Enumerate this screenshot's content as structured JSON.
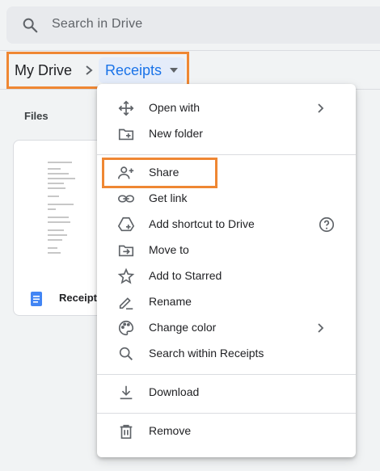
{
  "search": {
    "placeholder": "Search in Drive",
    "icon": "search-icon"
  },
  "breadcrumb": {
    "root": "My Drive",
    "current": "Receipts"
  },
  "files": {
    "section_label": "Files",
    "items": [
      {
        "name": "Receipt",
        "icon": "doc-icon"
      }
    ]
  },
  "context_menu": {
    "items": [
      {
        "label": "Open with",
        "icon": "open-with-icon",
        "has_submenu": true
      },
      {
        "label": "New folder",
        "icon": "new-folder-icon"
      },
      {
        "label": "Share",
        "icon": "share-icon",
        "highlighted": true
      },
      {
        "label": "Get link",
        "icon": "link-icon"
      },
      {
        "label": "Add shortcut to Drive",
        "icon": "add-shortcut-icon",
        "has_help": true
      },
      {
        "label": "Move to",
        "icon": "move-to-icon"
      },
      {
        "label": "Add to Starred",
        "icon": "star-icon"
      },
      {
        "label": "Rename",
        "icon": "rename-icon"
      },
      {
        "label": "Change color",
        "icon": "palette-icon",
        "has_submenu": true
      },
      {
        "label": "Search within Receipts",
        "icon": "search-icon"
      },
      {
        "label": "Download",
        "icon": "download-icon"
      },
      {
        "label": "Remove",
        "icon": "trash-icon"
      }
    ]
  },
  "colors": {
    "highlight": "#ef8733",
    "accent": "#1a73e8",
    "chip": "#e4ecfa",
    "text": "#202124"
  }
}
